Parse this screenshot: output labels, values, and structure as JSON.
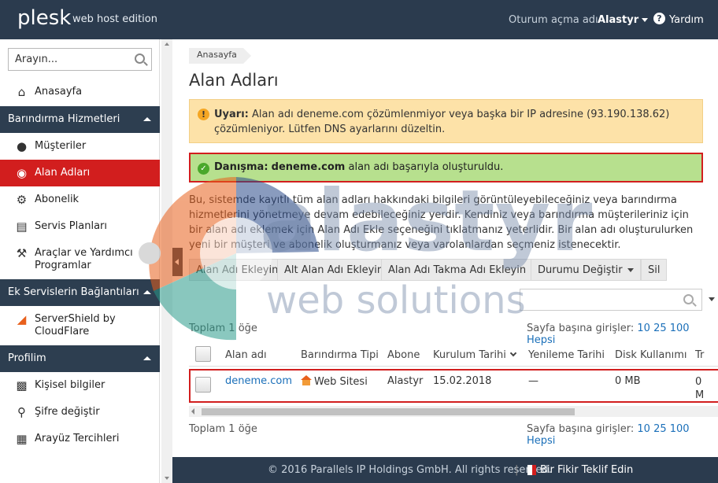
{
  "header": {
    "logo": "plesk",
    "edition": "web host edition",
    "login_label": "Oturum açma adı",
    "user_name": "Alastyr",
    "help_label": "Yardım"
  },
  "sidebar": {
    "search_placeholder": "Arayın...",
    "home_label": "Anasayfa",
    "sections": [
      {
        "title": "Barındırma Hizmetleri",
        "items": [
          "Müşteriler",
          "Alan Adları",
          "Abonelik",
          "Servis Planları",
          "Araçlar ve Yardımcı Programlar"
        ]
      },
      {
        "title": "Ek Servislerin Bağlantıları",
        "items": [
          "ServerShield by CloudFlare"
        ]
      },
      {
        "title": "Profilim",
        "items": [
          "Kişisel bilgiler",
          "Şifre değiştir",
          "Arayüz Tercihleri"
        ]
      }
    ],
    "active_item": "Alan Adları"
  },
  "main": {
    "breadcrumb": "Anasayfa",
    "title": "Alan Adları",
    "warning_label": "Uyarı:",
    "warning_text": "Alan adı deneme.com çözümlenmiyor veya başka bir IP adresine (93.190.138.62) çözümleniyor. Lütfen DNS ayarlarını düzeltin.",
    "info_label": "Danışma:",
    "info_domain": "deneme.com",
    "info_text": "alan adı başarıyla oluşturuldu.",
    "description": "Bu, sistemde kayıtlı tüm alan adları hakkındaki bilgileri görüntüleyebileceğiniz veya barındırma hizmetlerini yönetmeye devam edebileceğiniz yerdir. Kendiniz veya barındırma müşterileriniz için bir alan adı eklemek için Alan Adı Ekle seçeneğini tıklatmanız yeterlidir. Bir alan adı oluşturulurken yeni bir müşteri ve abonelik oluşturmanız veya varolanlardan seçmeniz istenecektir.",
    "toolbar": [
      "Alan Adı Ekleyin",
      "Alt Alan Adı Ekleyin",
      "Alan Adı Takma Adı Ekleyin",
      "Durumu Değiştir",
      "Sil"
    ],
    "total_label": "Toplam 1 öğe",
    "per_page_label": "Sayfa başına girişler:",
    "per_page_options": [
      "10",
      "25",
      "100",
      "Hepsi"
    ],
    "columns": [
      "Alan adı",
      "Barındırma Tipi",
      "Abone",
      "Kurulum Tarihi",
      "Yenileme Tarihi",
      "Disk Kullanımı",
      "Tr"
    ],
    "rows": [
      {
        "domain": "deneme.com",
        "hosting_type": "Web Sitesi",
        "subscriber": "Alastyr",
        "setup_date": "15.02.2018",
        "renewal_date": "—",
        "disk_usage": "0 MB",
        "traffic": "0 M"
      }
    ]
  },
  "footer": {
    "copyright": "© 2016 Parallels IP Holdings GmbH. All rights reserved.",
    "feedback": "Bir Fikir Teklif Edin"
  },
  "watermark": {
    "line1": "alastyr",
    "line2": "web solutions"
  },
  "colors": {
    "header_bg": "#2b3b4e",
    "active_red": "#d21e1e",
    "warning_bg": "#fde2a8",
    "success_bg": "#b7e08e",
    "link": "#1a6fb9"
  }
}
